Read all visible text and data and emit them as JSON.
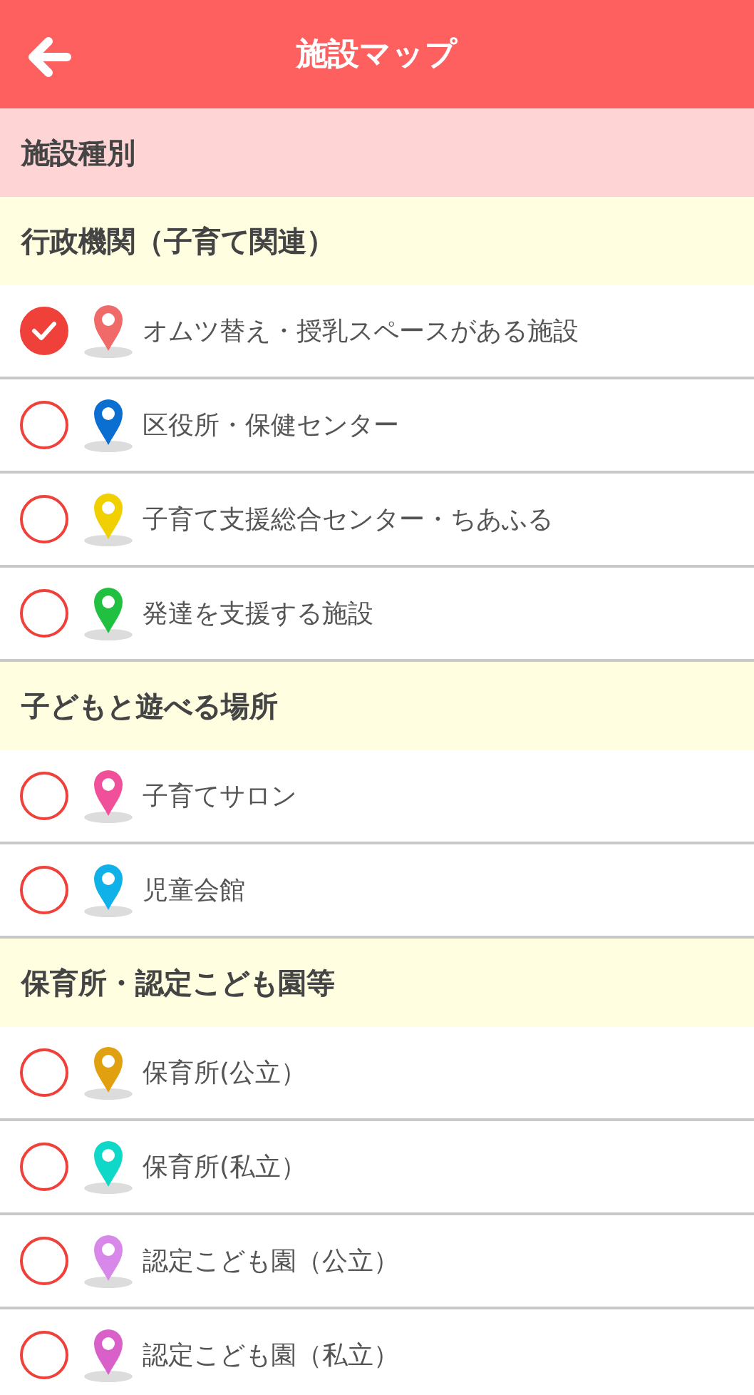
{
  "header": {
    "title": "施設マップ"
  },
  "section": {
    "title": "施設種別"
  },
  "groups": [
    {
      "title": "行政機関（子育て関連）",
      "items": [
        {
          "label": "オムツ替え・授乳スペースがある施設",
          "checked": true,
          "color": "#f06a6a"
        },
        {
          "label": "区役所・保健センター",
          "checked": false,
          "color": "#0a6fd0"
        },
        {
          "label": "子育て支援総合センター・ちあふる",
          "checked": false,
          "color": "#f0d000"
        },
        {
          "label": "発達を支援する施設",
          "checked": false,
          "color": "#22c040"
        }
      ]
    },
    {
      "title": "子どもと遊べる場所",
      "items": [
        {
          "label": "子育てサロン",
          "checked": false,
          "color": "#f0509a"
        },
        {
          "label": "児童会館",
          "checked": false,
          "color": "#10b0e8"
        }
      ]
    },
    {
      "title": "保育所・認定こども園等",
      "items": [
        {
          "label": "保育所(公立）",
          "checked": false,
          "color": "#e0a010"
        },
        {
          "label": "保育所(私立）",
          "checked": false,
          "color": "#10d8c8"
        },
        {
          "label": "認定こども園（公立）",
          "checked": false,
          "color": "#d888e8"
        },
        {
          "label": "認定こども園（私立）",
          "checked": false,
          "color": "#d860c8"
        }
      ]
    }
  ]
}
